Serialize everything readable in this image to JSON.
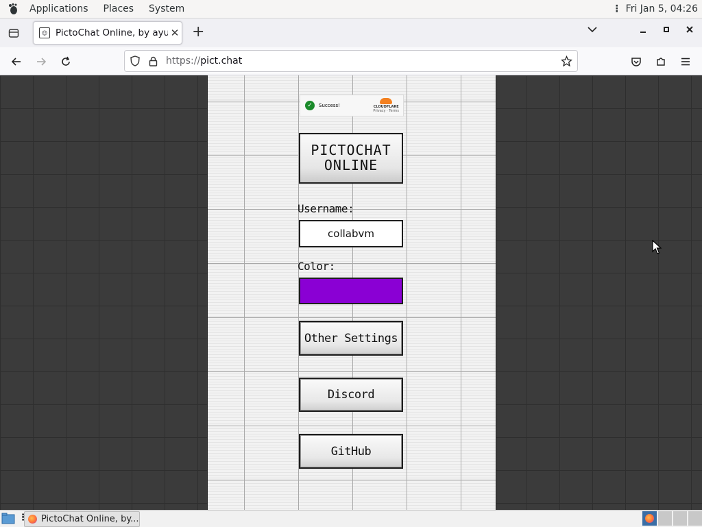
{
  "topbar": {
    "applications": "Applications",
    "places": "Places",
    "system": "System",
    "clock": "Fri Jan  5, 04:26"
  },
  "browser": {
    "tab_title": "PictoChat Online, by ayunami",
    "url_scheme": "https://",
    "url_host": "pict.chat"
  },
  "page": {
    "captcha": {
      "status": "Success!",
      "brand": "CLOUDFLARE",
      "links": "Privacy  ·  Terms"
    },
    "logo_line1": "PICTOCHAT",
    "logo_line2": "ONLINE",
    "username_label": "Username:",
    "username_value": "collabvm",
    "color_label": "Color:",
    "color_value": "#8a00d4",
    "other_settings": "Other Settings",
    "discord": "Discord",
    "github": "GitHub"
  },
  "taskbar": {
    "window_label": "PictoChat Online, by..."
  }
}
